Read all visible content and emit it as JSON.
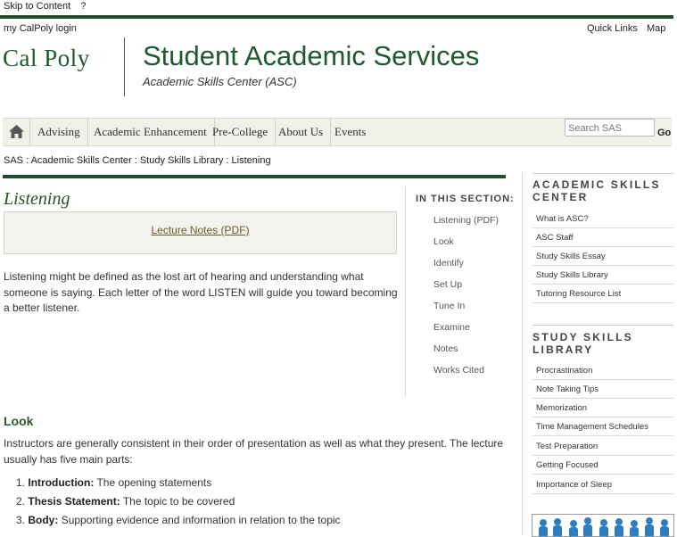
{
  "skip_links": [
    "Skip to Content",
    "?"
  ],
  "header": {
    "mylogin": "my CalPoly login",
    "quick_links": "Quick Links",
    "map": "Map",
    "logo_text": "Cal Poly",
    "site_title": "Student Academic Services",
    "subtitle": "Academic Skills Center (ASC)"
  },
  "nav": {
    "items": [
      "Advising",
      "Academic Enhancement",
      "Pre-College",
      "About Us",
      "Events"
    ],
    "search_placeholder": "Search SAS",
    "go": "Go"
  },
  "breadcrumb": "SAS : Academic Skills Center : Study Skills Library : Listening",
  "page": {
    "title": "Listening",
    "pdf_link": "Lecture Notes (PDF)",
    "intro_lines": [
      "Listening might be defined as the lost art of hearing and understanding what",
      "someone is saying. Each letter of the word LISTEN will guide you toward becoming",
      "a better listener."
    ],
    "look_heading": "Look",
    "look_lines": [
      "Instructors are generally consistent in their order of presentation as well as what they present. The lecture",
      "usually has five main parts:"
    ],
    "list": [
      {
        "num": "1.",
        "term": "Introduction:",
        "text": " The opening statements"
      },
      {
        "num": "2.",
        "term": "Thesis Statement:",
        "text": " The topic to be covered"
      },
      {
        "num": "3.",
        "term": "Body:",
        "text": " Supporting evidence and information in relation to the topic"
      }
    ]
  },
  "section_nav": {
    "heading": "IN THIS SECTION:",
    "items": [
      "Listening (PDF)",
      "Look",
      "Identify",
      "Set Up",
      "Tune In",
      "Examine",
      "Notes",
      "Works Cited"
    ]
  },
  "sidebar": {
    "asc_heading": [
      "ACADEMIC SKILLS",
      "CENTER"
    ],
    "asc_items": [
      "What is ASC?",
      "ASC Staff",
      "Study Skills Essay",
      "Study Skills Library",
      "Tutoring Resource List"
    ],
    "ssl_heading": [
      "STUDY SKILLS",
      "LIBRARY"
    ],
    "ssl_items": [
      "Procrastination",
      "Note Taking Tips",
      "Memorization",
      "Time Management Schedules",
      "Test Preparation",
      "Getting Focused",
      "Importance of Sleep"
    ]
  },
  "colors": {
    "brand_green": "#1e4d2b",
    "nav_bg": "#f1f1ea",
    "link_gold": "#6a5a2a"
  }
}
